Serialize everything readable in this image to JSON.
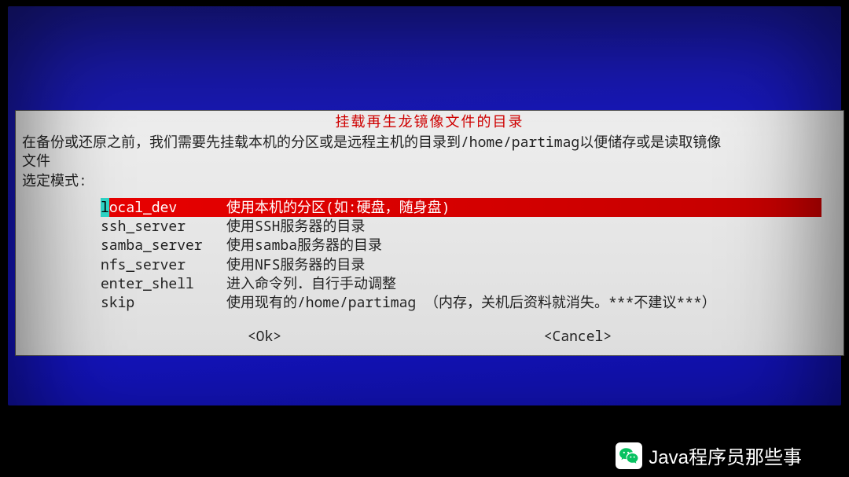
{
  "dialog": {
    "title": "挂载再生龙镜像文件的目录",
    "description": "在备份或还原之前，我们需要先挂载本机的分区或是远程主机的目录到/home/partimag以便储存或是读取镜像\n文件\n选定模式:",
    "buttons": {
      "ok": "<Ok>",
      "cancel": "<Cancel>"
    }
  },
  "menu": [
    {
      "key": "local_dev",
      "label": "使用本机的分区(如:硬盘，随身盘)",
      "selected": true
    },
    {
      "key": "ssh_server",
      "label": "使用SSH服务器的目录",
      "selected": false
    },
    {
      "key": "samba_server",
      "label": "使用samba服务器的目录",
      "selected": false
    },
    {
      "key": "nfs_server",
      "label": "使用NFS服务器的目录",
      "selected": false
    },
    {
      "key": "enter_shell",
      "label": "进入命令列．自行手动调整",
      "selected": false
    },
    {
      "key": "skip",
      "label": "使用现有的/home/partimag （内存，关机后资料就消失。***不建议***）",
      "selected": false
    }
  ],
  "watermark": {
    "text": "Java程序员那些事"
  }
}
